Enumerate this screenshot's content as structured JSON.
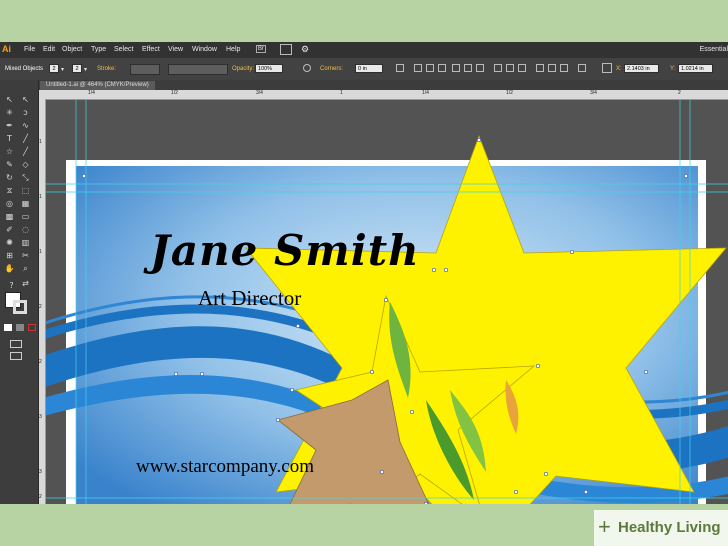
{
  "app": {
    "logo": "Ai",
    "workspace": "Essential"
  },
  "menu": [
    "File",
    "Edit",
    "Object",
    "Type",
    "Select",
    "Effect",
    "View",
    "Window",
    "Help"
  ],
  "menu_badge": "Br",
  "control_bar": {
    "selection": "Mixed Objects",
    "stroke_label": "Stroke:",
    "opacity_label": "Opacity:",
    "opacity_value": "100%",
    "corners_label": "Corners:",
    "corners_value": "0 in",
    "x_label": "X:",
    "x_value": "2.1403 in",
    "y_label": "Y:",
    "y_value": "1.0214 in",
    "fill_num": "2",
    "stroke_num": "2"
  },
  "document_tab": "Untitled-1.ai @ 464% (CMYK/Preview)",
  "ruler": {
    "h_ticks": [
      "1/4",
      "1/2",
      "3/4",
      "1",
      "1/4",
      "1/2",
      "3/4",
      "2"
    ],
    "v_ticks": [
      "1",
      "1",
      "1",
      "2",
      "2",
      "3",
      "3",
      "2"
    ]
  },
  "card": {
    "name": "Jane Smith",
    "title": "Art Director",
    "website": "www.starcompany.com"
  },
  "watermark": {
    "plus": "+",
    "text": "Healthy Living"
  },
  "colors": {
    "star_yellow": "#fff200",
    "star_brown": "#c29a6b",
    "wave_blue": "#1c73c2",
    "card_light": "#cde4f5",
    "card_dark": "#3f87cf",
    "app_bg": "#535353",
    "page_bg": "#b8d3a3"
  }
}
